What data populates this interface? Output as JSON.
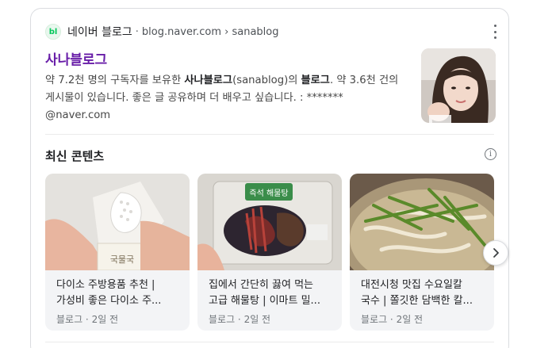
{
  "result": {
    "favicon_text": "bl",
    "site_name": "네이버 블로그",
    "separator": "·",
    "site_url": "blog.naver.com › sanablog",
    "title": "사나블로그",
    "desc_prefix": "약 7.2천 명의 구독자를 보유한 ",
    "desc_bold_1": "사나블로그",
    "desc_mid": "(sanablog)의 ",
    "desc_bold_2": "블로그",
    "desc_suffix": ". 약 3.6천 건의 게시물이 있습니다. 좋은 글 공유하며 더 배우고 싶습니다. : ******* @naver.com"
  },
  "section": {
    "title": "최신 콘텐츠",
    "info_icon": "i"
  },
  "items": [
    {
      "line1": "다이소 주방용품 추천 |",
      "line2": "가성비 좋은 다이소 주...",
      "meta": "블로그 · 2일 전",
      "image_text": "국물국"
    },
    {
      "line1": "집에서 간단히 끓여 먹는",
      "line2": "고급 해물탕 | 이마트 밀...",
      "meta": "블로그 · 2일 전",
      "image_text": "즉석 해물탕"
    },
    {
      "line1": "대전시청 맛집 수요일칼",
      "line2": "국수 | 쫄깃한 담백한 칼...",
      "meta": "블로그 · 2일 전",
      "image_text": ""
    }
  ],
  "colors": {
    "title_link": "#681da8",
    "naver_green": "#03c75a",
    "card_bg": "#f3f4f6"
  },
  "icons": [
    "naver-blog-favicon",
    "more-vert-icon",
    "info-icon",
    "chevron-right-icon"
  ]
}
